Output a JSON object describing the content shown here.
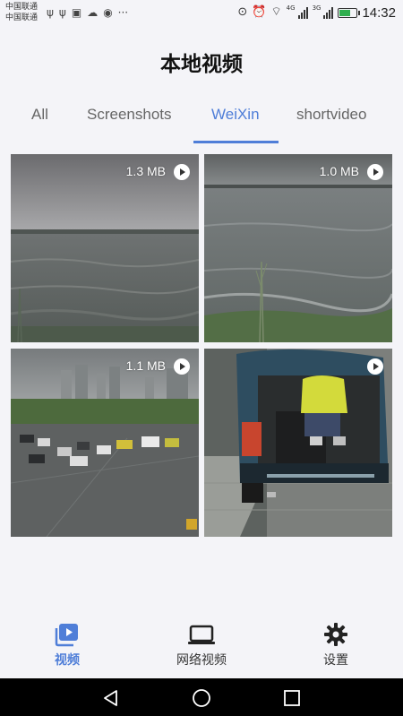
{
  "status_bar": {
    "carrier_line1": "中国联通",
    "carrier_line2": "中国联通",
    "net_tag_1": "4G",
    "net_tag_2": "3G",
    "time": "14:32"
  },
  "header": {
    "title": "本地视频"
  },
  "tabs": [
    {
      "label": "All",
      "active": false
    },
    {
      "label": "Screenshots",
      "active": false
    },
    {
      "label": "WeiXin",
      "active": true
    },
    {
      "label": "shortvideo",
      "active": false
    }
  ],
  "videos": [
    {
      "size": "1.3 MB",
      "scene": "lake-overcast",
      "play_icon": "play-icon"
    },
    {
      "size": "1.0 MB",
      "scene": "lake-shore-grass",
      "play_icon": "play-icon"
    },
    {
      "size": "1.1 MB",
      "scene": "city-traffic-rain",
      "play_icon": "play-icon"
    },
    {
      "size": "",
      "scene": "car-trunk-person",
      "play_icon": "play-icon"
    }
  ],
  "bottom_nav": [
    {
      "label": "视频",
      "icon": "video-library-icon",
      "active": true
    },
    {
      "label": "网络视频",
      "icon": "laptop-icon",
      "active": false
    },
    {
      "label": "设置",
      "icon": "gear-icon",
      "active": false
    }
  ],
  "system_nav": {
    "icons": [
      "back-icon",
      "home-icon",
      "recents-icon"
    ]
  },
  "colors": {
    "accent": "#4f7ed8",
    "background": "#f4f4f8"
  }
}
